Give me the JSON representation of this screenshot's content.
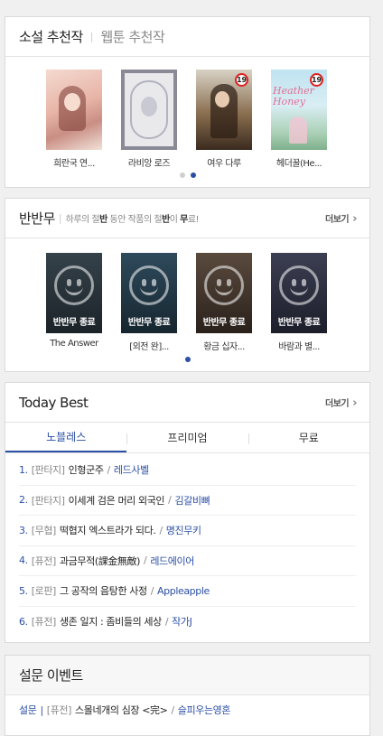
{
  "novel": {
    "tab_active": "소설 추천작",
    "tab_other": "웹툰 추천작",
    "books": [
      {
        "title": "희란국 연...",
        "badge": ""
      },
      {
        "title": "라비앙 로즈",
        "badge": ""
      },
      {
        "title": "여우 다루",
        "badge": "19"
      },
      {
        "title": "헤더꿀(He...",
        "badge": "19",
        "cover_text": "Heather Honey"
      }
    ]
  },
  "banbanmu": {
    "title": "반반무",
    "sub_1": "하루의 절",
    "sub_b1": "반",
    "sub_2": " 동안 작품의 절",
    "sub_b2": "반",
    "sub_3": "이 ",
    "sub_b3": "무",
    "sub_4": "료!",
    "more": "더보기",
    "end_label": "반반무 종료",
    "books": [
      {
        "title": "The Answer"
      },
      {
        "title": "[외전 완]..."
      },
      {
        "title": "황금 십자..."
      },
      {
        "title": "바람과 별..."
      }
    ]
  },
  "today_best": {
    "title": "Today Best",
    "more": "더보기",
    "tabs": [
      "노블레스",
      "프리미엄",
      "무료"
    ],
    "items": [
      {
        "num": "1.",
        "genre": "[판타지]",
        "title": "인형군주",
        "author": "레드사벨"
      },
      {
        "num": "2.",
        "genre": "[판타지]",
        "title": "이세계 검은 머리 외국인",
        "author": "김갈비뼈"
      },
      {
        "num": "3.",
        "genre": "[무협]",
        "title": "떡협지 엑스트라가 되다.",
        "author": "명진무키"
      },
      {
        "num": "4.",
        "genre": "[퓨전]",
        "title": "과금무적(課金無敵)",
        "author": "레드에이어"
      },
      {
        "num": "5.",
        "genre": "[로판]",
        "title": "그 공작의 음탕한 사정",
        "author": "Appleapple"
      },
      {
        "num": "6.",
        "genre": "[퓨전]",
        "title": "생존 일지 : 좀비들의 세상",
        "author": "작가J"
      }
    ]
  },
  "survey": {
    "title": "설문 이벤트",
    "tag": "설문",
    "divider": "|",
    "genre": "[퓨전]",
    "text": "스몰네개의 심장 <完>",
    "author": "슬피우는영혼"
  }
}
